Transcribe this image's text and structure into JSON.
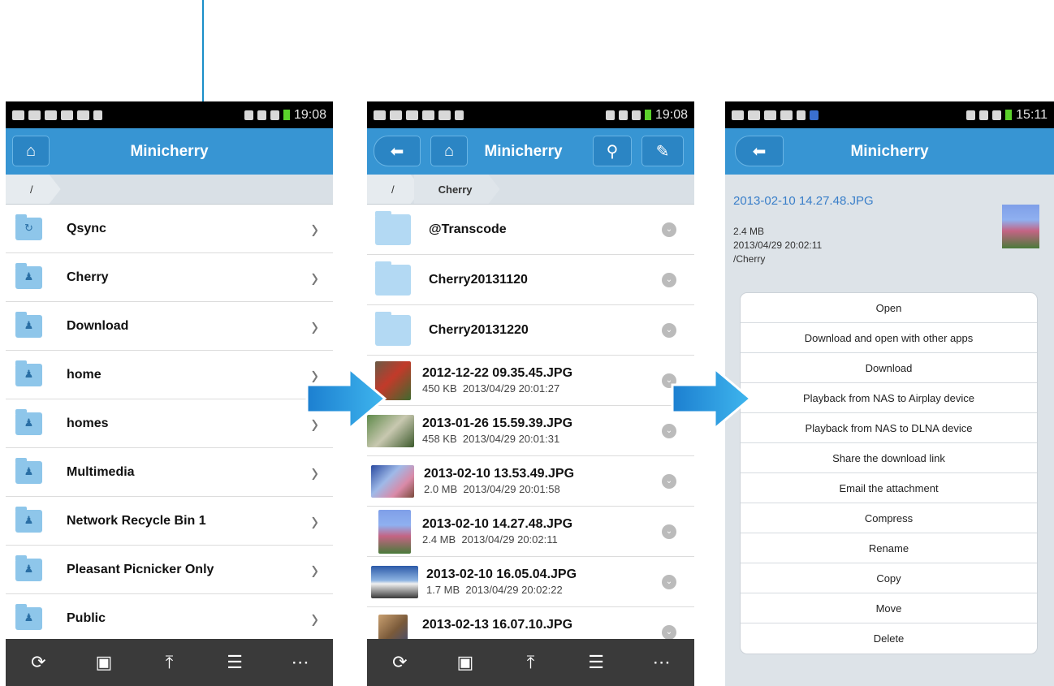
{
  "app": {
    "title": "Minicherry"
  },
  "screens": {
    "root": {
      "time": "19:08",
      "breadcrumb": [
        "/"
      ],
      "items": [
        {
          "name": "Qsync",
          "glyph": "↻"
        },
        {
          "name": "Cherry",
          "glyph": "♟"
        },
        {
          "name": "Download",
          "glyph": "♟"
        },
        {
          "name": "home",
          "glyph": "♟"
        },
        {
          "name": "homes",
          "glyph": "♟"
        },
        {
          "name": "Multimedia",
          "glyph": "♟"
        },
        {
          "name": "Network Recycle Bin 1",
          "glyph": "♟"
        },
        {
          "name": "Pleasant Picnicker Only",
          "glyph": "♟"
        },
        {
          "name": "Public",
          "glyph": "♟"
        }
      ]
    },
    "folder": {
      "time": "19:08",
      "breadcrumb": [
        "/",
        "Cherry"
      ],
      "folders": [
        "@Transcode",
        "Cherry20131120",
        "Cherry20131220"
      ],
      "files": [
        {
          "name": "2012-12-22 09.35.45.JPG",
          "size": "450 KB",
          "date": "2013/04/29 20:01:27"
        },
        {
          "name": "2013-01-26 15.59.39.JPG",
          "size": "458 KB",
          "date": "2013/04/29 20:01:31"
        },
        {
          "name": "2013-02-10 13.53.49.JPG",
          "size": "2.0 MB",
          "date": "2013/04/29 20:01:58"
        },
        {
          "name": "2013-02-10 14.27.48.JPG",
          "size": "2.4 MB",
          "date": "2013/04/29 20:02:11"
        },
        {
          "name": "2013-02-10 16.05.04.JPG",
          "size": "1.7 MB",
          "date": "2013/04/29 20:02:22"
        },
        {
          "name": "2013-02-13 16.07.10.JPG",
          "size": "",
          "date": ""
        }
      ]
    },
    "detail": {
      "time": "15:11",
      "file_name": "2013-02-10 14.27.48.JPG",
      "size": "2.4 MB",
      "date": "2013/04/29 20:02:11",
      "path": "/Cherry",
      "actions": [
        "Open",
        "Download and open with other apps",
        "Download",
        "Playback from NAS to Airplay device",
        "Playback from NAS to DLNA device",
        "Share the download link",
        "Email the attachment",
        "Compress",
        "Rename",
        "Copy",
        "Move",
        "Delete"
      ]
    }
  },
  "icons": {
    "home": "home-icon",
    "back": "back-arrow-icon",
    "search": "search-icon",
    "edit": "pencil-icon",
    "refresh": "refresh-icon",
    "new_folder": "new-folder-icon",
    "upload": "upload-icon",
    "sort": "sort-icon",
    "more": "more-icon"
  },
  "colors": {
    "accent": "#3795d3",
    "bottom_bar": "#3a3a3a",
    "callout": "#1a8fc9"
  }
}
